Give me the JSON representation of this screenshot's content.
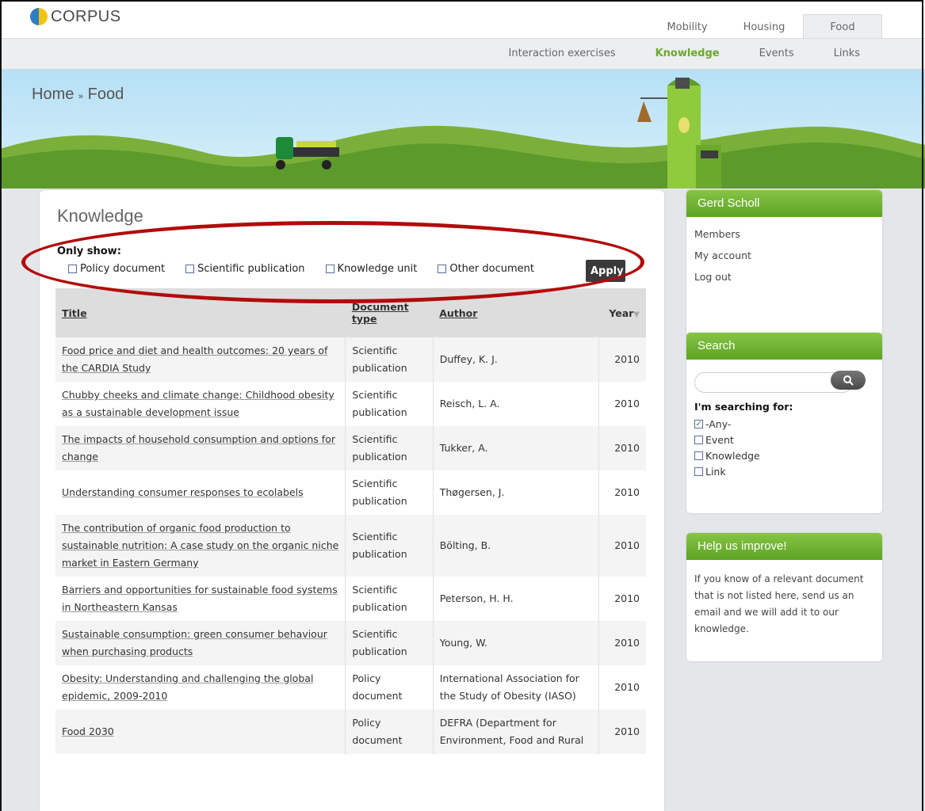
{
  "brand": {
    "name": "CORPUS"
  },
  "main_tabs": [
    "Mobility",
    "Housing",
    "Food"
  ],
  "sub_nav": {
    "items": [
      "Interaction exercises",
      "Knowledge",
      "Events",
      "Links"
    ],
    "active": "Knowledge"
  },
  "breadcrumb": {
    "home": "Home",
    "sep": "»",
    "current": "Food"
  },
  "main": {
    "heading": "Knowledge",
    "only_show": "Only show:",
    "filters": [
      "Policy document",
      "Scientific publication",
      "Knowledge unit",
      "Other document"
    ],
    "apply_label": "Apply",
    "columns": {
      "title": "Title",
      "type": "Document type",
      "author": "Author",
      "year": "Year"
    },
    "rows": [
      {
        "title": "Food price and diet and health outcomes: 20 years of the CARDIA Study",
        "type": "Scientific publication",
        "author": "Duffey, K. J.",
        "year": "2010"
      },
      {
        "title": "Chubby cheeks and climate change: Childhood obesity as a sustainable development issue",
        "type": "Scientific publication",
        "author": "Reisch, L. A.",
        "year": "2010"
      },
      {
        "title": "The impacts of household consumption and options for change",
        "type": "Scientific publication",
        "author": "Tukker, A.",
        "year": "2010"
      },
      {
        "title": "Understanding consumer responses to ecolabels",
        "type": "Scientific publication",
        "author": "Thøgersen, J.",
        "year": "2010"
      },
      {
        "title": "The contribution of organic food production to sustainable nutrition: A case study on the organic niche market in Eastern Germany",
        "type": "Scientific publication",
        "author": "Bölting, B.",
        "year": "2010"
      },
      {
        "title": "Barriers and opportunities for sustainable food systems in Northeastern Kansas",
        "type": "Scientific publication",
        "author": "Peterson, H. H.",
        "year": "2010"
      },
      {
        "title": "Sustainable consumption: green consumer behaviour when purchasing products",
        "type": "Scientific publication",
        "author": "Young, W.",
        "year": "2010"
      },
      {
        "title": "Obesity: Understanding and challenging the global epidemic, 2009-2010",
        "type": "Policy document",
        "author": "International Association for the Study of Obesity (IASO)",
        "year": "2010"
      },
      {
        "title": "Food 2030",
        "type": "Policy document",
        "author": "DEFRA (Department for Environment, Food and Rural",
        "year": "2010"
      }
    ]
  },
  "user_card": {
    "name": "Gerd Scholl",
    "links": [
      "Members",
      "My account",
      "Log out"
    ]
  },
  "search_card": {
    "title": "Search",
    "value": "",
    "searching_for": "I'm searching for:",
    "options": [
      {
        "label": "-Any-",
        "checked": true
      },
      {
        "label": "Event",
        "checked": false
      },
      {
        "label": "Knowledge",
        "checked": false
      },
      {
        "label": "Link",
        "checked": false
      }
    ]
  },
  "help_card": {
    "title": "Help us improve!",
    "text": "If you know of a relevant document that is not listed here, send us an email and we will add it to our knowledge."
  },
  "colors": {
    "accent_green": "#6aa92a",
    "annotation_red": "#b20b0b"
  }
}
